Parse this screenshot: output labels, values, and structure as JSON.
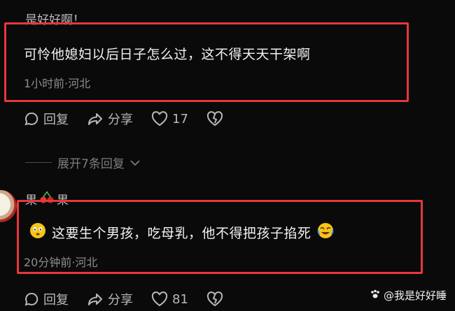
{
  "comment1": {
    "username": "是好好啊！",
    "text": "可怜他媳妇以后日子怎么过，这不得天天干架啊",
    "meta": "1小时前·河北",
    "reply_label": "回复",
    "share_label": "分享",
    "like_count": "17"
  },
  "expand_replies": {
    "label": "展开7条回复"
  },
  "comment2": {
    "username_part1": "果",
    "username_part2": "果",
    "text": "这要生个男孩，吃母乳，他不得把孩子掐死",
    "meta": "20分钟前·河北",
    "reply_label": "回复",
    "share_label": "分享",
    "like_count": "81"
  },
  "watermark": {
    "text": "@我是好好睡"
  },
  "colors": {
    "highlight_box": "#e8373b",
    "background": "#0a0a0a"
  }
}
